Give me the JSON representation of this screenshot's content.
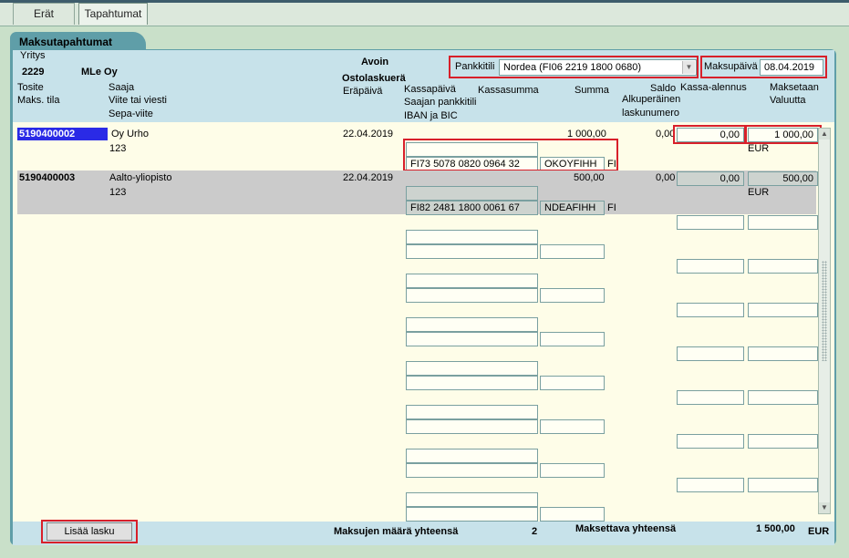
{
  "tabs": [
    {
      "label": "Erät"
    },
    {
      "label": "Tapahtumat"
    }
  ],
  "panel_title": "Maksutapahtumat",
  "header": {
    "yritys_label": "Yritys",
    "company_code": "2229",
    "company_name": "MLe Oy",
    "avoin": "Avoin",
    "ostolaskuera": "Ostolaskuerä",
    "pankkitili_label": "Pankkitili",
    "pankkitili_value": "Nordea (FI06 2219 1800 0680)",
    "maksupaiva_label": "Maksupäivä",
    "maksupaiva_value": "08.04.2019",
    "col_tosite": "Tosite",
    "col_maks_tila": "Maks. tila",
    "col_saaja": "Saaja",
    "col_viite": "Viite tai viesti",
    "col_sepa": "Sepa-viite",
    "col_erapaiva": "Eräpäivä",
    "col_kassapaiva": "Kassapäivä",
    "col_saajan_pankkitili": "Saajan pankkitili",
    "col_iban_bic": "IBAN ja BIC",
    "col_kassasumma": "Kassasumma",
    "col_summa": "Summa",
    "col_saldo": "Saldo",
    "col_alkuperainen": "Alkuperäinen",
    "col_laskunumero": "laskunumero",
    "col_kassa_alennus": "Kassa-alennus",
    "col_maksetaan": "Maksetaan",
    "col_valuutta": "Valuutta"
  },
  "rows": [
    {
      "tosite": "5190400002",
      "saaja": "Oy Urho",
      "viite": "123",
      "erapaiva": "22.04.2019",
      "summa": "1 000,00",
      "saldo": "0,00",
      "kassa_alennus": "0,00",
      "maksetaan": "1 000,00",
      "valuutta": "EUR",
      "iban": "FI73 5078 0820 0964 32",
      "bic": "OKOYFIHH",
      "country": "FI"
    },
    {
      "tosite": "5190400003",
      "saaja": "Aalto-yliopisto",
      "viite": "123",
      "erapaiva": "22.04.2019",
      "summa": "500,00",
      "saldo": "0,00",
      "kassa_alennus": "0,00",
      "maksetaan": "500,00",
      "valuutta": "EUR",
      "iban": "FI82 2481 1800 0061 67",
      "bic": "NDEAFIHH",
      "country": "FI"
    }
  ],
  "footer": {
    "add_button": "Lisää lasku",
    "count_label": "Maksujen määrä yhteensä",
    "count_value": "2",
    "total_label": "Maksettava yhteensä",
    "total_value": "1 500,00",
    "currency": "EUR"
  },
  "colors": {
    "panel": "#5f9ea8",
    "header_bg": "#c7e2ea",
    "content_bg": "#fefde8",
    "highlight": "#d8202a",
    "selected": "#2a2ae6"
  }
}
